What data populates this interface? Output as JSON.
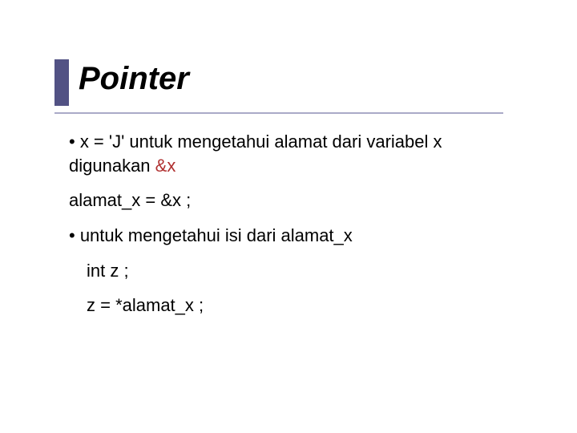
{
  "title": "Pointer",
  "body": {
    "p1_a": "• x = 'J' untuk mengetahui alamat dari variabel x digunakan ",
    "p1_amp": "&x",
    "p2": "alamat_x  = &x ;",
    "p3": "• untuk mengetahui isi dari alamat_x",
    "p4": "int  z ;",
    "p5": "z = *alamat_x ;"
  }
}
